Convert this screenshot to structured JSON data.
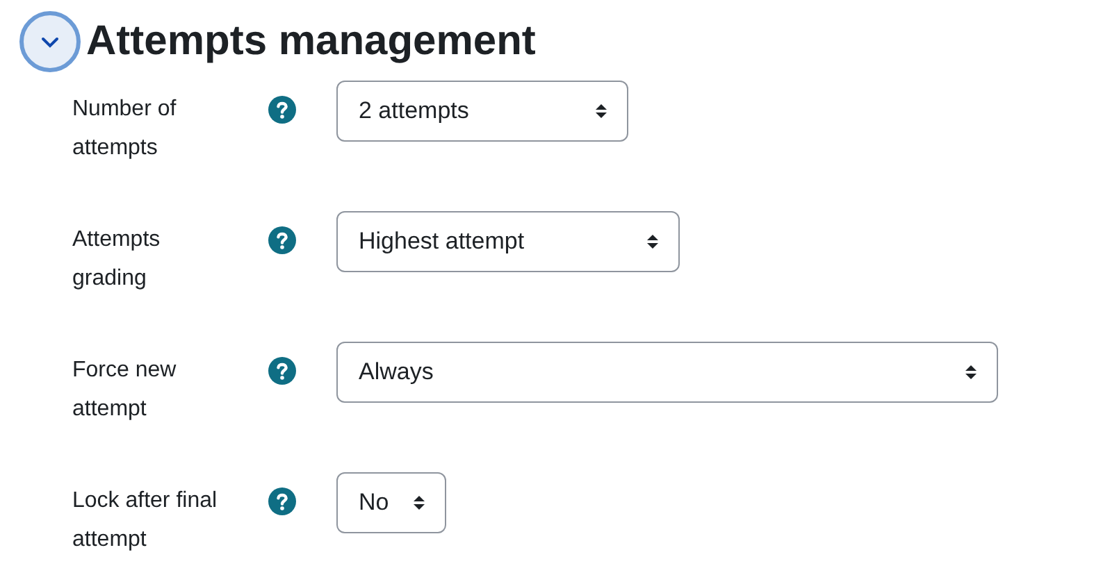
{
  "section": {
    "title": "Attempts management",
    "expanded": true
  },
  "fields": [
    {
      "label": "Number of attempts",
      "value": "2 attempts"
    },
    {
      "label": "Attempts grading",
      "value": "Highest attempt"
    },
    {
      "label": "Force new attempt",
      "value": "Always"
    },
    {
      "label": "Lock after final attempt",
      "value": "No"
    }
  ]
}
